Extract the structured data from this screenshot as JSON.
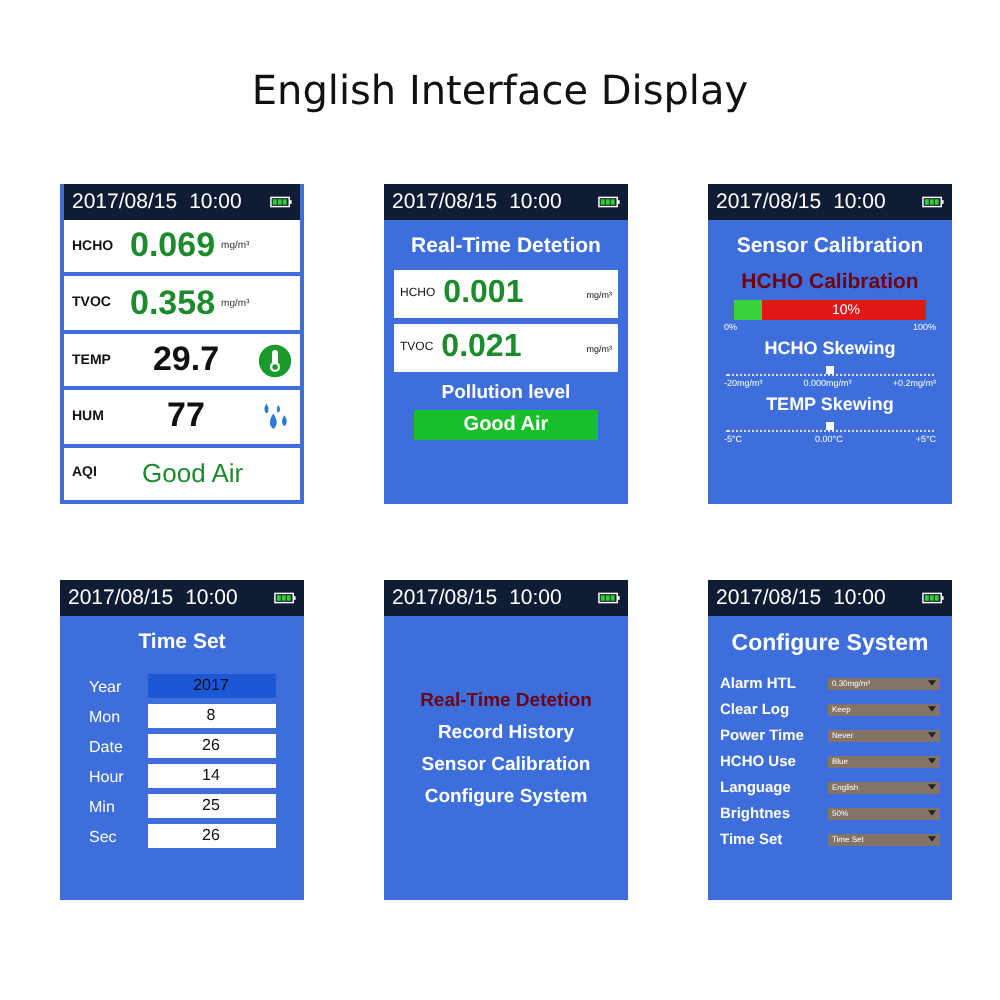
{
  "title": "English Interface Display",
  "screens": [
    {
      "kind": "readings",
      "date": "2017/08/15",
      "time": "10:00",
      "rows": [
        {
          "kind": "measure",
          "label": "HCHO",
          "value": "0.069",
          "unit": "mg/m³"
        },
        {
          "kind": "measure",
          "label": "TVOC",
          "value": "0.358",
          "unit": "mg/m³"
        },
        {
          "kind": "thermometer",
          "label": "TEMP",
          "value": "29.7"
        },
        {
          "kind": "droplets",
          "label": "HUM",
          "value": "77"
        },
        {
          "kind": "status",
          "label": "AQI",
          "value": "Good Air"
        }
      ]
    },
    {
      "kind": "detection",
      "date": "2017/08/15",
      "time": "10:00",
      "title": "Real-Time Detetion",
      "readings": [
        {
          "label": "HCHO",
          "value": "0.001",
          "unit": "mg/m³"
        },
        {
          "label": "TVOC",
          "value": "0.021",
          "unit": "mg/m³"
        }
      ],
      "pollution_label": "Pollution level",
      "status": "Good Air"
    },
    {
      "kind": "calibration",
      "date": "2017/08/15",
      "time": "10:00",
      "title": "Sensor Calibration",
      "subtitle": "HCHO Calibration",
      "progress": {
        "level": 0.15,
        "text": "10%",
        "min": "0%",
        "max": "100%"
      },
      "sliders": [
        {
          "title": "HCHO Skewing",
          "level": 0.5,
          "min": "-20mg/m³",
          "mid": "0.000mg/m³",
          "max": "+0.2mg/m³"
        },
        {
          "title": "TEMP Skewing",
          "level": 0.5,
          "min": "-5°C",
          "mid": "0.00°C",
          "max": "+5°C"
        }
      ]
    },
    {
      "kind": "time_set",
      "date": "2017/08/15",
      "time": "10:00",
      "title": "Time Set",
      "fields": [
        {
          "label": "Year",
          "value": "2017",
          "selected": true
        },
        {
          "label": "Mon",
          "value": "8",
          "selected": false
        },
        {
          "label": "Date",
          "value": "26",
          "selected": false
        },
        {
          "label": "Hour",
          "value": "14",
          "selected": false
        },
        {
          "label": "Min",
          "value": "25",
          "selected": false
        },
        {
          "label": "Sec",
          "value": "26",
          "selected": false
        }
      ]
    },
    {
      "kind": "menu",
      "date": "2017/08/15",
      "time": "10:00",
      "items": [
        {
          "label": "Real-Time Detetion",
          "selected": true
        },
        {
          "label": "Record History",
          "selected": false
        },
        {
          "label": "Sensor Calibration",
          "selected": false
        },
        {
          "label": "Configure System",
          "selected": false
        }
      ]
    },
    {
      "kind": "config",
      "date": "2017/08/15",
      "time": "10:00",
      "title": "Configure System",
      "settings": [
        {
          "label": "Alarm HTL",
          "value": "0.30mg/m³"
        },
        {
          "label": "Clear Log",
          "value": "Keep"
        },
        {
          "label": "Power Time",
          "value": "Never"
        },
        {
          "label": "HCHO Use",
          "value": "Blue"
        },
        {
          "label": "Language",
          "value": "English"
        },
        {
          "label": "Brightnes",
          "value": "50%"
        },
        {
          "label": "Time Set",
          "value": "Time Set"
        }
      ]
    }
  ]
}
